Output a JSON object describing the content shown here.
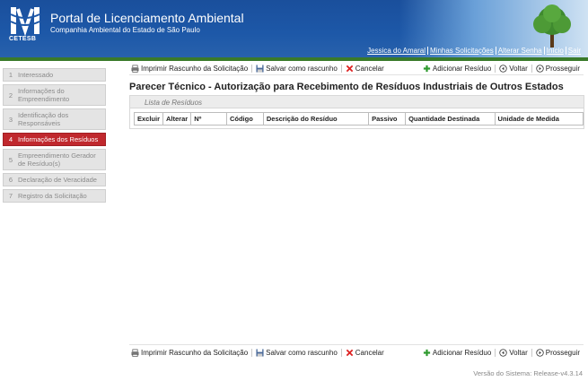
{
  "header": {
    "logo_text": "CETESB",
    "title": "Portal de Licenciamento Ambiental",
    "subtitle": "Companhia Ambiental do Estado de São Paulo",
    "user_links": [
      "Jessica do Amaral",
      "Minhas Solicitações",
      "Alterar Senha",
      "Início",
      "Sair"
    ],
    "colors": {
      "header_blue": "#1d58a8",
      "accent_red": "#c0282d",
      "green": "#3a7a2a"
    }
  },
  "sidebar": {
    "steps": [
      {
        "num": "1",
        "label": "Interessado"
      },
      {
        "num": "2",
        "label": "Informações do Empreendimento"
      },
      {
        "num": "3",
        "label": "Identificação dos Responsáveis"
      },
      {
        "num": "4",
        "label": "Informações dos Resíduos"
      },
      {
        "num": "5",
        "label": "Empreendimento Gerador de Resíduo(s)"
      },
      {
        "num": "6",
        "label": "Declaração de Veracidade"
      },
      {
        "num": "7",
        "label": "Registro da Solicitação"
      }
    ]
  },
  "toolbar": {
    "print": "Imprimir Rascunho da Solicitação",
    "save": "Salvar como rascunho",
    "cancel": "Cancelar",
    "add": "Adicionar Resíduo",
    "back": "Voltar",
    "next": "Prosseguir",
    "icons": [
      "printer-icon",
      "floppy-disk-icon",
      "red-x-icon",
      "green-plus-icon",
      "back-circle-icon",
      "forward-circle-icon"
    ]
  },
  "main": {
    "title": "Parecer Técnico - Autorização para Recebimento de Resíduos Industriais de Outros Estados",
    "panel_title": "Lista de Resíduos",
    "columns": [
      "Excluir",
      "Alterar",
      "Nº",
      "Código",
      "Descrição do Resíduo",
      "Passivo",
      "Quantidade Destinada",
      "Unidade de Medida"
    ]
  },
  "footer": {
    "version": "Versão do Sistema: Release-v4.3.14"
  }
}
